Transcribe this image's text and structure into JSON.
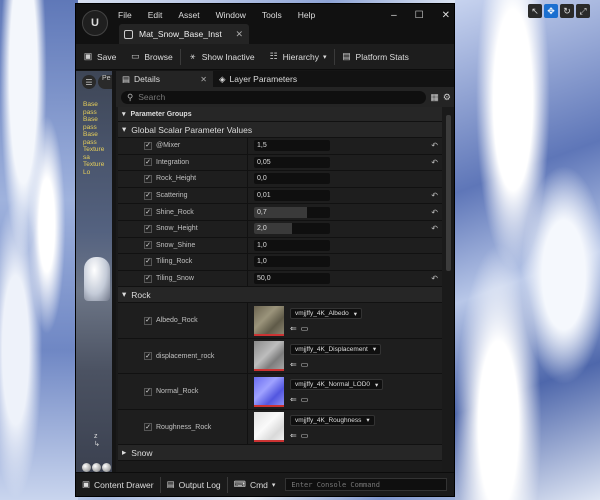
{
  "menu": [
    "File",
    "Edit",
    "Asset",
    "Window",
    "Tools",
    "Help"
  ],
  "document_tab": "Mat_Snow_Base_Inst",
  "toolbar": {
    "save": "Save",
    "browse": "Browse",
    "show_inactive": "Show Inactive",
    "hierarchy": "Hierarchy",
    "platform_stats": "Platform Stats"
  },
  "viewport": {
    "perspective": "Pe",
    "stats": [
      "Base pass",
      "Base pass",
      "Base pass",
      "Texture sa",
      "Texture Lo"
    ]
  },
  "panel_tabs": {
    "details": "Details",
    "layer_parameters": "Layer Parameters"
  },
  "search": {
    "placeholder": "Search"
  },
  "sections": {
    "parameter_groups": "Parameter Groups",
    "global_scalar": "Global Scalar Parameter Values",
    "rock": "Rock",
    "snow": "Snow"
  },
  "scalar_params": [
    {
      "name": "@Mixer",
      "value": "1,5",
      "reset": true,
      "slider": 0
    },
    {
      "name": "Integration",
      "value": "0,05",
      "reset": true,
      "slider": 0
    },
    {
      "name": "Rock_Height",
      "value": "0,0",
      "reset": false,
      "slider": 0
    },
    {
      "name": "Scattering",
      "value": "0,01",
      "reset": true,
      "slider": 0
    },
    {
      "name": "Shine_Rock",
      "value": "0,7",
      "reset": true,
      "slider": 0.7
    },
    {
      "name": "Snow_Height",
      "value": "2,0",
      "reset": true,
      "slider": 0.5
    },
    {
      "name": "Snow_Shine",
      "value": "1,0",
      "reset": false,
      "slider": 0
    },
    {
      "name": "Tiling_Rock",
      "value": "1,0",
      "reset": false,
      "slider": 0
    },
    {
      "name": "Tiling_Snow",
      "value": "50,0",
      "reset": true,
      "slider": 0
    }
  ],
  "texture_params": [
    {
      "name": "Albedo_Rock",
      "asset": "vmjjffy_4K_Albedo",
      "kind": "albedo"
    },
    {
      "name": "displacement_rock",
      "asset": "vmjjffy_4K_Displacement",
      "kind": "disp"
    },
    {
      "name": "Normal_Rock",
      "asset": "vmjjffy_4K_Normal_LOD0",
      "kind": "normal"
    },
    {
      "name": "Roughness_Rock",
      "asset": "vmjjffy_4K_Roughness",
      "kind": "rough"
    }
  ],
  "bottom": {
    "content_drawer": "Content Drawer",
    "output_log": "Output Log",
    "cmd": "Cmd",
    "console_placeholder": "Enter Console Command"
  },
  "colors": {
    "accent": "#1b6fd0",
    "texture_underline": "#cc3333"
  }
}
